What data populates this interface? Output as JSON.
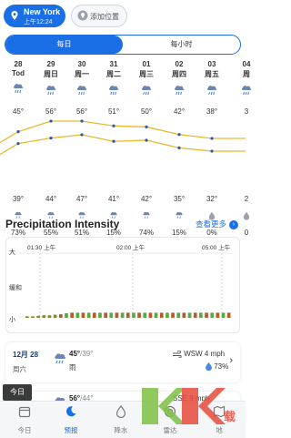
{
  "location": {
    "city": "New York",
    "time": "上午12:24",
    "add_label": "添加位置"
  },
  "tabs": {
    "daily": "每日",
    "hourly": "每小时"
  },
  "days": [
    {
      "date": "28",
      "weekday": "Tod",
      "high": "45°",
      "low": "39°",
      "precip": "73%"
    },
    {
      "date": "29",
      "weekday": "周日",
      "high": "56°",
      "low": "44°",
      "precip": "55%"
    },
    {
      "date": "30",
      "weekday": "周一",
      "high": "56°",
      "low": "47°",
      "precip": "51%"
    },
    {
      "date": "31",
      "weekday": "周二",
      "high": "51°",
      "low": "41°",
      "precip": "15%"
    },
    {
      "date": "01",
      "weekday": "周三",
      "high": "50°",
      "low": "42°",
      "precip": "74%"
    },
    {
      "date": "02",
      "weekday": "周四",
      "high": "42°",
      "low": "35°",
      "precip": "15%"
    },
    {
      "date": "03",
      "weekday": "周五",
      "high": "38°",
      "low": "32°",
      "precip": "0%"
    },
    {
      "date": "04",
      "weekday": "周",
      "high": "3",
      "low": "2",
      "precip": "0"
    }
  ],
  "precip_section": {
    "title": "Precipitation Intensity",
    "see_more": "查看更多",
    "y_labels": {
      "high": "大",
      "mid": "缓和",
      "low": "小"
    },
    "time_labels": [
      "01:30 上午",
      "02:00 上午",
      "05:00 上午"
    ],
    "chart_data": {
      "type": "bar",
      "ylim": [
        0,
        10
      ],
      "values": [
        0.3,
        0.3,
        0.4,
        0.5,
        0.5,
        0.6,
        0.7,
        0.9,
        1.0,
        1.0,
        1.0,
        1.0,
        1.0,
        1.0,
        1.0,
        1.0,
        1.0,
        1.0,
        1.0,
        1.0,
        1.0,
        1.0,
        1.0,
        1.0,
        1.0,
        1.0,
        1.0,
        1.0,
        1.0,
        1.0,
        1.0,
        1.0,
        1.0,
        1.0,
        1.0,
        1.0,
        1.0
      ],
      "colors": {
        "rain": "#8a8a2a",
        "heavy": "#b85a2e",
        "light": "#5aa84a"
      }
    }
  },
  "daily_cards": [
    {
      "date": "12月 28",
      "weekday": "周六",
      "high": "45°",
      "low": "/39°",
      "condition": "雨",
      "wind": "WSW 4 mph",
      "precip": "73%"
    },
    {
      "date": "",
      "weekday": "",
      "high": "56°",
      "low": "/44°",
      "condition": "",
      "wind": "SSE 9 mph",
      "precip": ""
    }
  ],
  "tooltip": "今日",
  "bottom_nav": [
    {
      "label": "今日",
      "icon": "calendar-icon"
    },
    {
      "label": "预报",
      "icon": "moon-icon"
    },
    {
      "label": "降水",
      "icon": "drop-icon"
    },
    {
      "label": "雷达",
      "icon": "radar-icon"
    },
    {
      "label": "地",
      "icon": "map-icon"
    }
  ],
  "colors": {
    "accent": "#1a6fe6",
    "high_line": "#e8b92c",
    "low_line": "#e8b92c"
  },
  "watermark": "KK下载"
}
